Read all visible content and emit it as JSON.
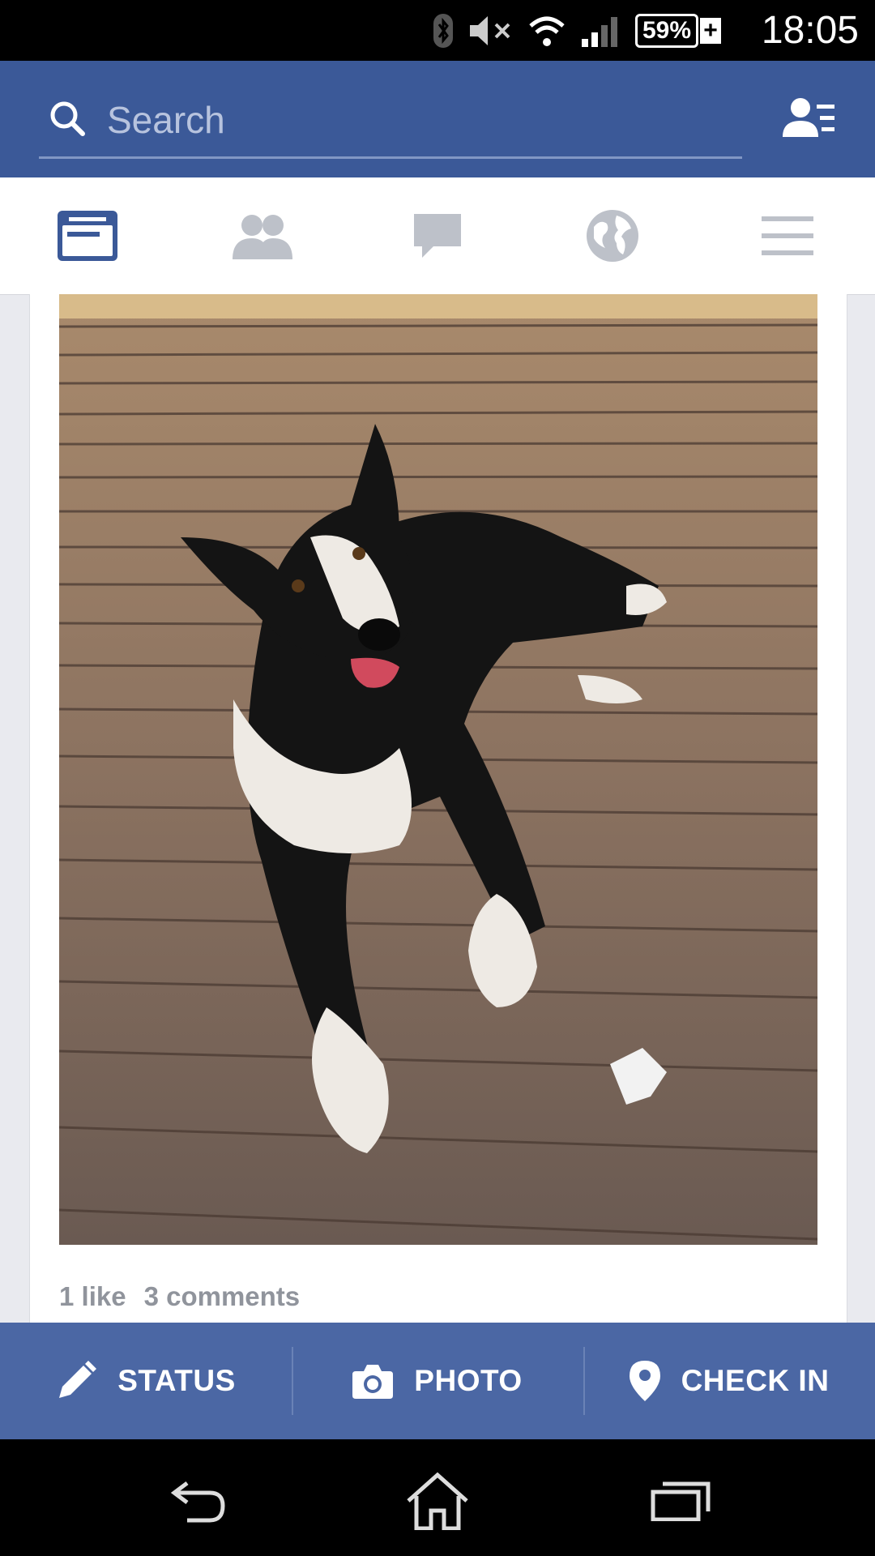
{
  "status_bar": {
    "time": "18:05",
    "battery_level": "59%",
    "icons": [
      "bluetooth-icon",
      "mute-icon",
      "wifi-icon",
      "signal-icon",
      "battery-icon"
    ]
  },
  "search": {
    "placeholder": "Search",
    "value": ""
  },
  "tabs": [
    {
      "name": "news-feed",
      "active": true
    },
    {
      "name": "friend-requests",
      "active": false
    },
    {
      "name": "messages",
      "active": false
    },
    {
      "name": "notifications",
      "active": false
    },
    {
      "name": "more",
      "active": false
    }
  ],
  "post": {
    "likes": "1 like",
    "comments": "3 comments"
  },
  "composer": {
    "status_label": "STATUS",
    "photo_label": "PHOTO",
    "checkin_label": "CHECK IN"
  },
  "colors": {
    "brand_blue": "#3b5998",
    "composer_blue": "#4b67a4",
    "inactive_icon": "#bdc1c9",
    "stats_text": "#90949c"
  }
}
